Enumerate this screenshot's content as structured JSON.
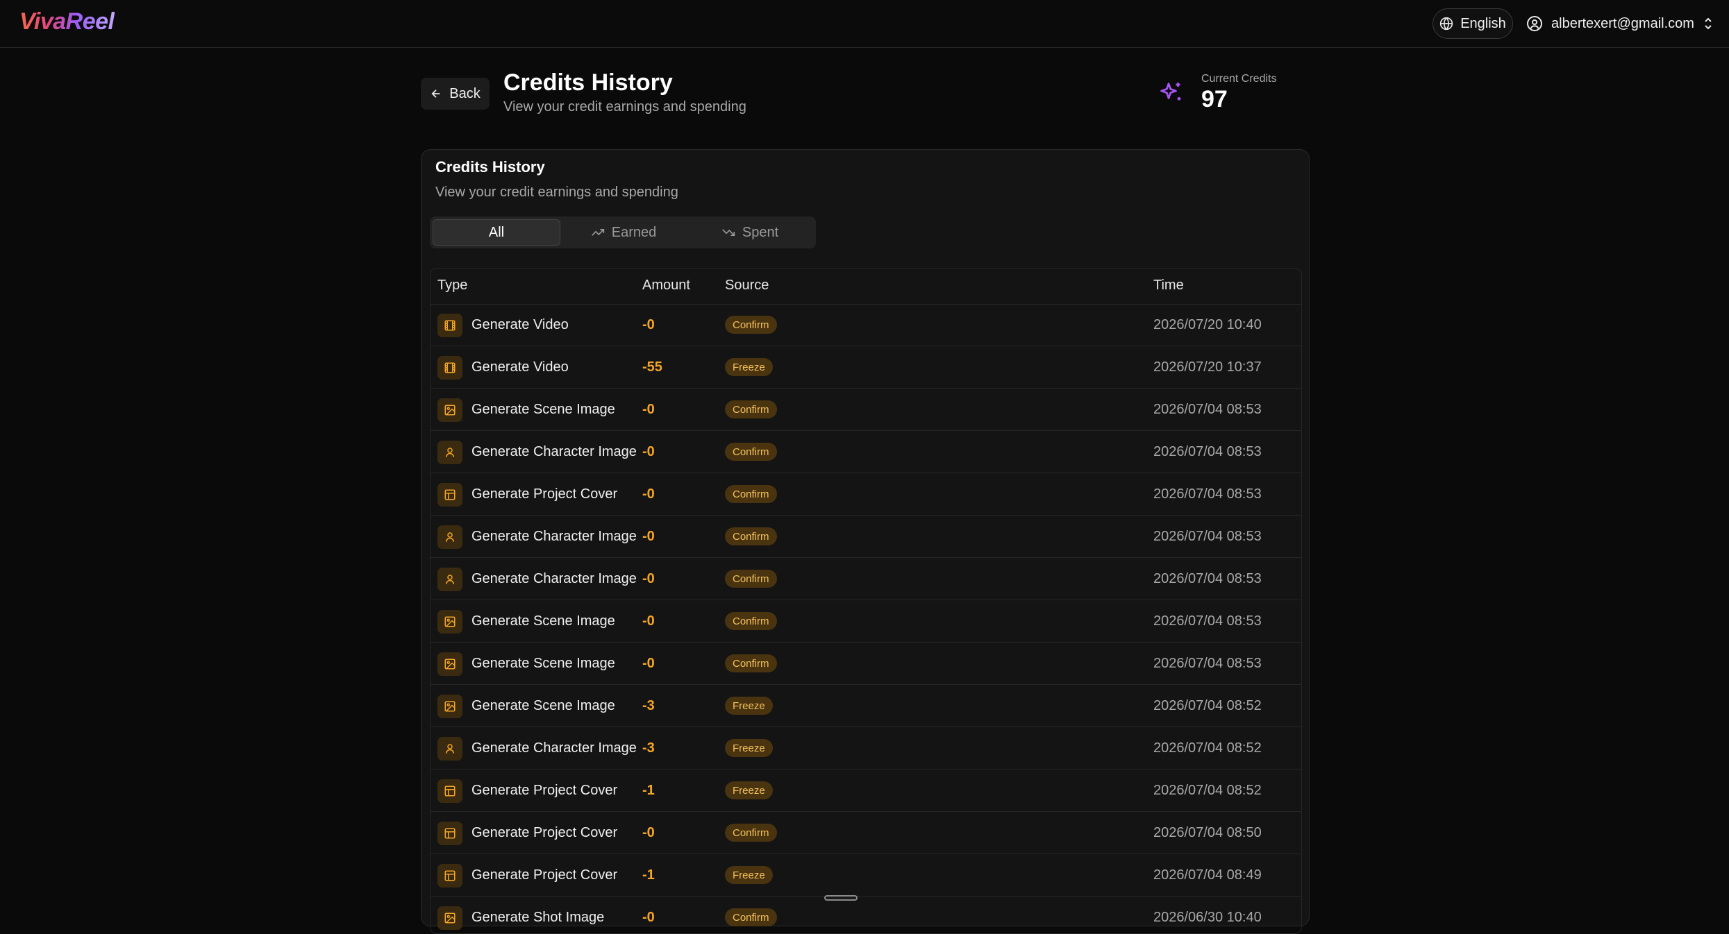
{
  "app": {
    "logo": "VivaReel"
  },
  "topbar": {
    "language": "English",
    "user_email": "albertexert@gmail.com"
  },
  "header": {
    "back_label": "Back",
    "title": "Credits History",
    "subtitle": "View your credit earnings and spending",
    "current_credits_label": "Current Credits",
    "current_credits_value": "97"
  },
  "card": {
    "title": "Credits History",
    "subtitle": "View your credit earnings and spending",
    "tabs": [
      {
        "label": "All",
        "active": true
      },
      {
        "label": "Earned",
        "active": false
      },
      {
        "label": "Spent",
        "active": false
      }
    ],
    "columns": {
      "type": "Type",
      "amount": "Amount",
      "source": "Source",
      "time": "Time"
    },
    "rows": [
      {
        "icon": "film-icon",
        "type": "Generate Video",
        "amount": "-0",
        "source": "Confirm",
        "time": "2026/07/20 10:40"
      },
      {
        "icon": "film-icon",
        "type": "Generate Video",
        "amount": "-55",
        "source": "Freeze",
        "time": "2026/07/20 10:37"
      },
      {
        "icon": "image-icon",
        "type": "Generate Scene Image",
        "amount": "-0",
        "source": "Confirm",
        "time": "2026/07/04 08:53"
      },
      {
        "icon": "user-icon",
        "type": "Generate Character Image",
        "amount": "-0",
        "source": "Confirm",
        "time": "2026/07/04 08:53"
      },
      {
        "icon": "layout-icon",
        "type": "Generate Project Cover",
        "amount": "-0",
        "source": "Confirm",
        "time": "2026/07/04 08:53"
      },
      {
        "icon": "user-icon",
        "type": "Generate Character Image",
        "amount": "-0",
        "source": "Confirm",
        "time": "2026/07/04 08:53"
      },
      {
        "icon": "user-icon",
        "type": "Generate Character Image",
        "amount": "-0",
        "source": "Confirm",
        "time": "2026/07/04 08:53"
      },
      {
        "icon": "image-icon",
        "type": "Generate Scene Image",
        "amount": "-0",
        "source": "Confirm",
        "time": "2026/07/04 08:53"
      },
      {
        "icon": "image-icon",
        "type": "Generate Scene Image",
        "amount": "-0",
        "source": "Confirm",
        "time": "2026/07/04 08:53"
      },
      {
        "icon": "image-icon",
        "type": "Generate Scene Image",
        "amount": "-3",
        "source": "Freeze",
        "time": "2026/07/04 08:52"
      },
      {
        "icon": "user-icon",
        "type": "Generate Character Image",
        "amount": "-3",
        "source": "Freeze",
        "time": "2026/07/04 08:52"
      },
      {
        "icon": "layout-icon",
        "type": "Generate Project Cover",
        "amount": "-1",
        "source": "Freeze",
        "time": "2026/07/04 08:52"
      },
      {
        "icon": "layout-icon",
        "type": "Generate Project Cover",
        "amount": "-0",
        "source": "Confirm",
        "time": "2026/07/04 08:50"
      },
      {
        "icon": "layout-icon",
        "type": "Generate Project Cover",
        "amount": "-1",
        "source": "Freeze",
        "time": "2026/07/04 08:49"
      },
      {
        "icon": "image-icon",
        "type": "Generate Shot Image",
        "amount": "-0",
        "source": "Confirm",
        "time": "2026/06/30 10:40"
      }
    ]
  },
  "colors": {
    "accent_amount": "#f5a524",
    "badge_bg": "#4a3410",
    "badge_text": "#f4c25a",
    "credits_icon": "#a855f7"
  }
}
